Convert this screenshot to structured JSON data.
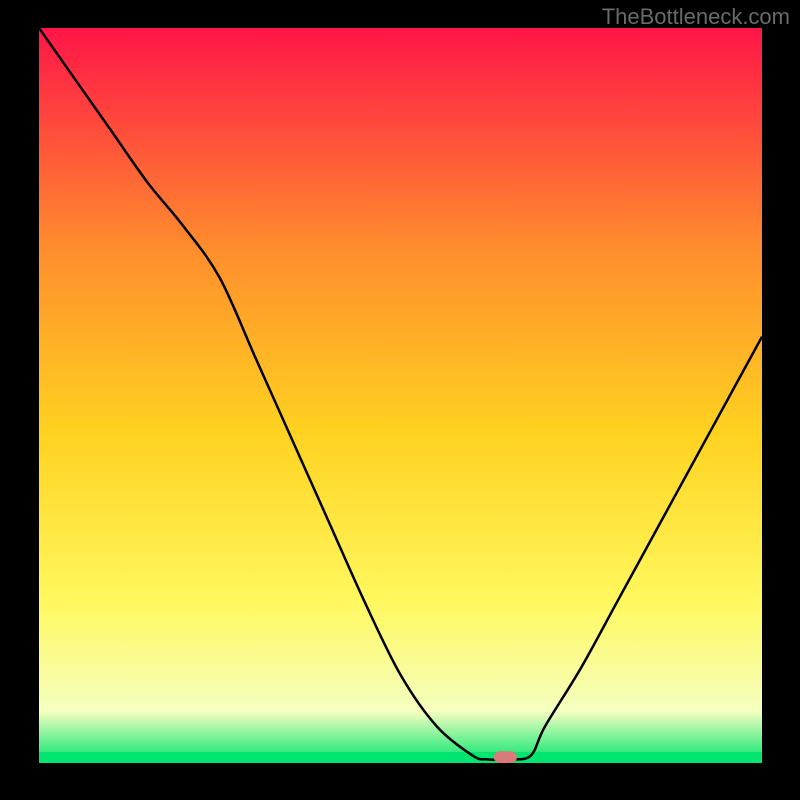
{
  "attribution": "TheBottleneck.com",
  "chart_data": {
    "type": "line",
    "title": "",
    "xlabel": "",
    "ylabel": "",
    "xlim": [
      0,
      100
    ],
    "ylim": [
      0,
      100
    ],
    "background_gradient": {
      "top": "#ff1548",
      "upper_mid": "#ff8d2d",
      "mid": "#ffd220",
      "lower_mid": "#fff85e",
      "near_bottom": "#f5ffc0",
      "bottom": "#00e56f"
    },
    "series": [
      {
        "name": "bottleneck-curve",
        "x": [
          0,
          5,
          10,
          15,
          20,
          25,
          30,
          35,
          40,
          45,
          50,
          55,
          60,
          62,
          65,
          68,
          70,
          75,
          80,
          85,
          90,
          95,
          100
        ],
        "y": [
          100,
          93,
          86,
          79,
          73,
          66,
          55,
          44,
          33,
          22,
          12,
          5,
          1,
          0.5,
          0.5,
          1,
          5,
          13,
          22,
          31,
          40,
          49,
          58
        ]
      }
    ],
    "marker": {
      "x": 64.5,
      "y": 0.8,
      "width": 3.2,
      "height": 1.6,
      "color": "#d97a7a"
    },
    "green_band_y": 1.5
  }
}
